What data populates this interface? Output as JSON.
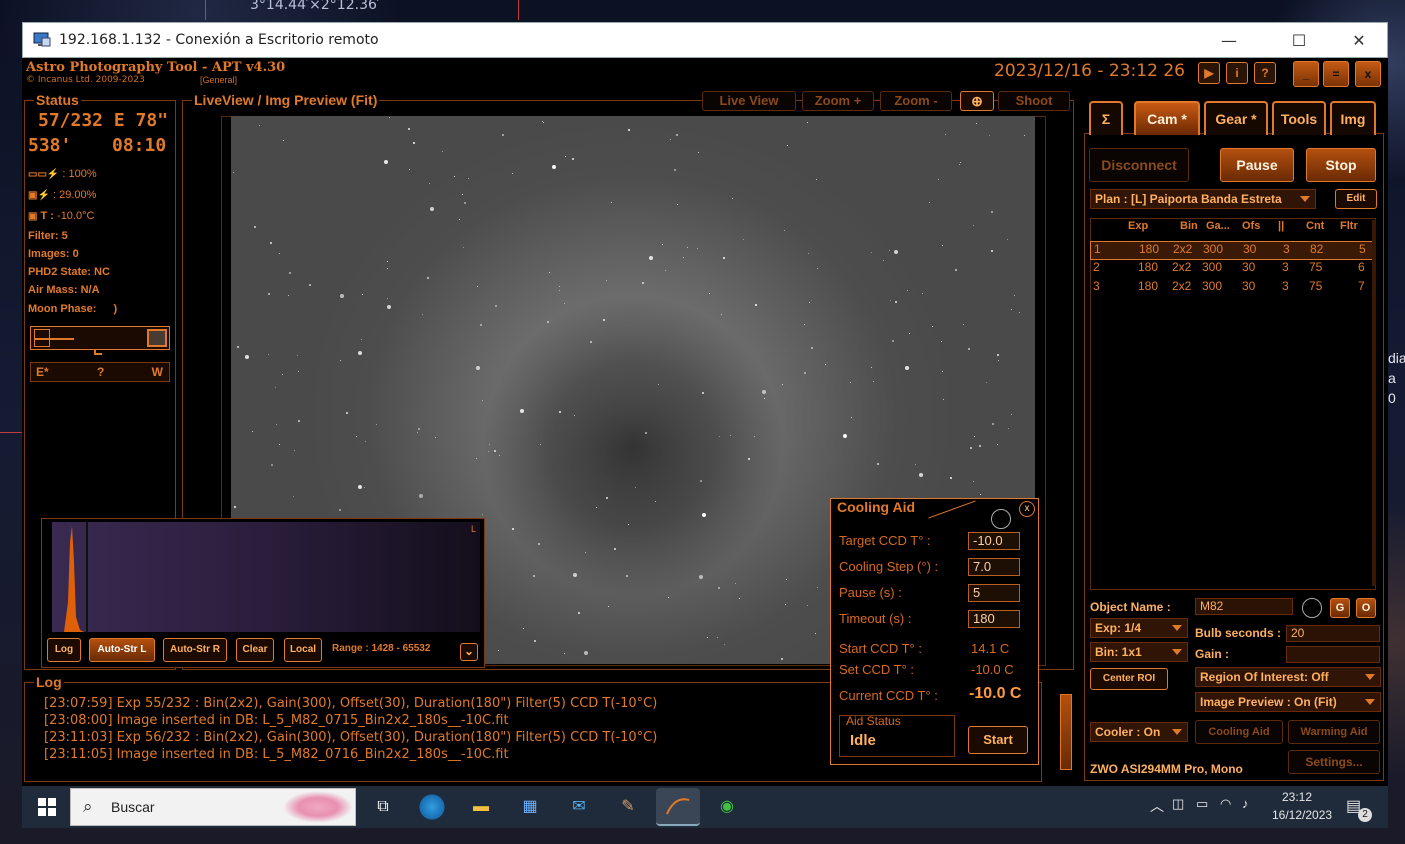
{
  "desktop": {
    "coord_text": "3°14.44′×2°12.36′",
    "side_text_1": "dia",
    "side_text_2": "a 0"
  },
  "rdp": {
    "title": "192.168.1.132 - Conexión a Escritorio remoto",
    "minimize": "—",
    "maximize": "☐",
    "close": "✕"
  },
  "apt": {
    "name": "Astro Photography Tool  -  APT v4.30",
    "copyright": "© Incanus Ltd. 2009-2023",
    "profile": "[General]",
    "datetime": "2023/12/16 - 23:12 26",
    "hdr_buttons": [
      "▶",
      "i",
      "?"
    ],
    "win_buttons": [
      "_",
      "=",
      "x"
    ]
  },
  "status": {
    "title": "Status",
    "coord1": "57/232 E  78\"",
    "coord2a": "538'",
    "coord2b": "08:10",
    "line_battery1": ": 100%",
    "line_battery2": ": 29.00%",
    "line_temp_label": "T :",
    "line_temp_value": "-10.0°C",
    "filter": "Filter: 5",
    "images": "Images: 0",
    "phd2": "PHD2 State: NC",
    "airmass": "Air Mass: N/A",
    "moon": "Moon Phase:",
    "moon_symbol": ")",
    "compass_e": "E*",
    "compass_q": "?",
    "compass_w": "W"
  },
  "liveview": {
    "title": "LiveView / Img Preview (Fit)",
    "buttons": [
      "Live View",
      "Zoom +",
      "Zoom -",
      "⊕",
      "Shoot"
    ]
  },
  "histogram": {
    "corner": "L",
    "buttons": [
      "Log",
      "Auto-Str L",
      "Auto-Str R",
      "Clear",
      "Local"
    ],
    "range": "Range : 1428 - 65532",
    "expand": "⌄"
  },
  "log": {
    "title": "Log",
    "lines": [
      "[23:07:59] Exp 55/232 : Bin(2x2), Gain(300), Offset(30), Duration(180\") Filter(5) CCD T(-10°C)",
      "[23:08:00] Image inserted in DB: L_5_M82_0715_Bin2x2_180s__-10C.fit",
      "[23:11:03] Exp 56/232 : Bin(2x2), Gain(300), Offset(30), Duration(180\") Filter(5) CCD T(-10°C)",
      "[23:11:05] Image inserted in DB: L_5_M82_0716_Bin2x2_180s__-10C.fit"
    ]
  },
  "cooling": {
    "title": "Cooling Aid",
    "close": "x",
    "target_label": "Target CCD T° :",
    "target_value": "-10.0",
    "step_label": "Cooling Step (°) :",
    "step_value": "7.0",
    "pause_label": "Pause (s) :",
    "pause_value": "5",
    "timeout_label": "Timeout (s) :",
    "timeout_value": "180",
    "start_label": "Start CCD T° :",
    "start_value": "14.1 C",
    "set_label": "Set CCD T° :",
    "set_value": "-10.0 C",
    "current_label": "Current CCD T° :",
    "current_value": "-10.0 C",
    "aid_status_label": "Aid Status",
    "aid_status_value": "Idle",
    "start_button": "Start"
  },
  "right": {
    "tabs": [
      "Σ",
      "Cam *",
      "Gear *",
      "Tools",
      "Img"
    ],
    "disconnect": "Disconnect",
    "pause": "Pause",
    "stop": "Stop",
    "plan": "Plan : [L] Paiporta Banda Estreta",
    "edit": "Edit",
    "table_headers": [
      "Exp",
      "Bin",
      "Ga...",
      "Ofs",
      "||",
      "Cnt",
      "Fltr"
    ],
    "rows": [
      [
        "1",
        "180",
        "2x2",
        "300",
        "30",
        "3",
        "82",
        "5"
      ],
      [
        "2",
        "180",
        "2x2",
        "300",
        "30",
        "3",
        "75",
        "6"
      ],
      [
        "3",
        "180",
        "2x2",
        "300",
        "30",
        "3",
        "75",
        "7"
      ]
    ],
    "object_label": "Object Name :",
    "object_value": "M82",
    "g_btn": "G",
    "o_btn": "O",
    "exp": "Exp: 1/4",
    "bin": "Bin: 1x1",
    "bulb_label": "Bulb seconds :",
    "bulb_value": "20",
    "gain_label": "Gain :",
    "gain_value": "",
    "center_roi": "Center ROI",
    "roi": "Region Of Interest: Off",
    "img_preview": "Image Preview : On (Fit)",
    "cooler": "Cooler : On",
    "cooling_aid": "Cooling Aid",
    "warming_aid": "Warming Aid",
    "camera": "ZWO ASI294MM Pro, Mono",
    "settings": "Settings..."
  },
  "taskbar": {
    "search": "Buscar",
    "time": "23:12",
    "date": "16/12/2023",
    "notif_count": "2"
  }
}
